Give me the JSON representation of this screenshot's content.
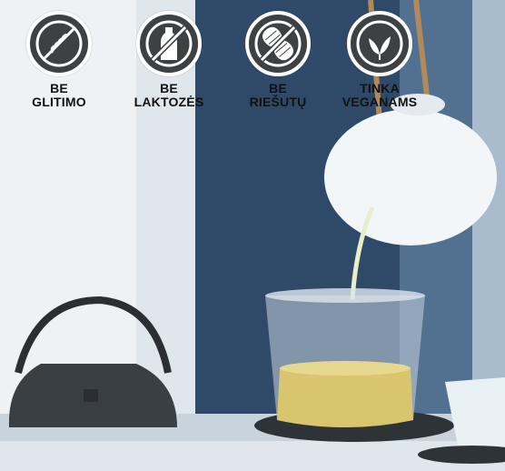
{
  "badges": [
    {
      "icon": "no-gluten-wheat-icon",
      "line1": "BE",
      "line2": "GLITIMO"
    },
    {
      "icon": "no-lactose-milk-bottle-icon",
      "line1": "BE",
      "line2": "LAKTOZĖS"
    },
    {
      "icon": "no-nuts-peanut-icon",
      "line1": "BE",
      "line2": "RIEŠUTŲ"
    },
    {
      "icon": "vegan-leaf-icon",
      "line1": "TINKA",
      "line2": "VEGANAMS"
    }
  ],
  "colors": {
    "badge_fill": "#3d4141",
    "badge_border": "#ffffff",
    "label_text": "#111111"
  },
  "photo": {
    "subject": "tea being poured from a white teapot into a glass cup"
  }
}
